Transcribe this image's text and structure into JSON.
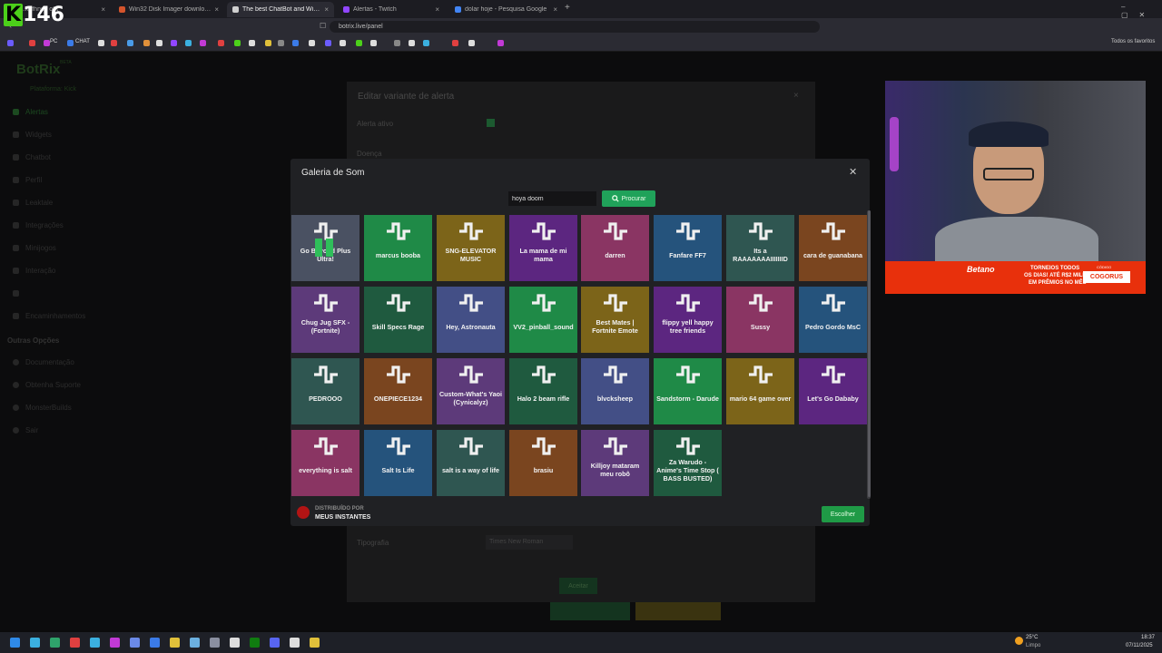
{
  "browser": {
    "tabs": [
      {
        "label": "...kefhney of t",
        "color": "#3b6ee8"
      },
      {
        "label": "Win32 Disk Imager download | Sour",
        "color": "#d4542c"
      },
      {
        "label": "The best ChatBot and Widget",
        "color": "#d0d0d0",
        "active": true
      },
      {
        "label": "Alertas - Twitch",
        "color": "#9146ff"
      },
      {
        "label": "dolar hoje - Pesquisa Google",
        "color": "#4285f4"
      }
    ],
    "url": "botrix.live/panel",
    "favorites_label": "Todos os favoritos",
    "bookmarks": [
      "PC",
      "CHAT"
    ]
  },
  "overlay_counter": {
    "letter": "K",
    "number": "146"
  },
  "sidebar": {
    "brand": "BotRix",
    "brand_badge": "BETA",
    "platform": "Plataforma: Kick",
    "items": [
      "Alertas",
      "Widgets",
      "Chatbot",
      "Perfil",
      "Leaktale",
      "Integrações",
      "Minijogos",
      "Interação",
      "",
      "Encaminhamentos"
    ],
    "other_title": "Outras Opções",
    "other_items": [
      "Documentação",
      "Obtenha Suporte",
      "MonsterBuilds",
      "Sair"
    ]
  },
  "edit_panel": {
    "title": "Editar variante de alerta",
    "active_label": "Alerta ativo",
    "type_label": "Doença",
    "typography_label": "Tipografia",
    "typography_value": "Times New Roman",
    "accept_label": "Aceitar"
  },
  "modal": {
    "title": "Galeria de Som",
    "search_value": "hoya doom",
    "search_button": "Procurar",
    "choose_button": "Escolher",
    "distributed_by": "DISTRIBUÍDO POR",
    "distributor": "MEUS INSTANTES",
    "sounds": [
      {
        "label": "Go Beyond Plus Ultra!",
        "color": "#4a5162",
        "playing": true
      },
      {
        "label": "marcus booba",
        "color": "#1f8a47"
      },
      {
        "label": "SNG-ELEVATOR MUSIC",
        "color": "#7c6419"
      },
      {
        "label": "La mama de mi mama",
        "color": "#5c2680"
      },
      {
        "label": "darren",
        "color": "#8a3563"
      },
      {
        "label": "Fanfare FF7",
        "color": "#25537c"
      },
      {
        "label": "Its a RAAAAAAAIIIIIIID",
        "color": "#2f5651"
      },
      {
        "label": "cara de guanabana",
        "color": "#7a451f"
      },
      {
        "label": "Chug Jug SFX - (Fortnite)",
        "color": "#5d3a7a"
      },
      {
        "label": "Skill Specs Rage",
        "color": "#1f5a3f"
      },
      {
        "label": "Hey, Astronauta",
        "color": "#434f86"
      },
      {
        "label": "VV2_pinball_sound",
        "color": "#1f8a47"
      },
      {
        "label": "Best Mates | Fortnite Emote",
        "color": "#7c6419"
      },
      {
        "label": "flippy yell happy tree friends",
        "color": "#5c2680"
      },
      {
        "label": "Sussy",
        "color": "#8a3563"
      },
      {
        "label": "Pedro Gordo MsC",
        "color": "#25537c"
      },
      {
        "label": "PEDROOO",
        "color": "#2f5651"
      },
      {
        "label": "ONEPIECE1234",
        "color": "#7a451f"
      },
      {
        "label": "Custom-What's Yaoi (Cynicalyz)",
        "color": "#5d3a7a"
      },
      {
        "label": "Halo 2 beam rifle",
        "color": "#1f5a3f"
      },
      {
        "label": "blvcksheep",
        "color": "#434f86"
      },
      {
        "label": "Sandstorm - Darude",
        "color": "#1f8a47"
      },
      {
        "label": "mario 64 game over",
        "color": "#7c6419"
      },
      {
        "label": "Let's Go Dababy",
        "color": "#5c2680"
      },
      {
        "label": "everything is salt",
        "color": "#8a3563"
      },
      {
        "label": "Salt Is Life",
        "color": "#25537c"
      },
      {
        "label": "salt is a way of life",
        "color": "#2f5651"
      },
      {
        "label": "brasiu",
        "color": "#7a451f"
      },
      {
        "label": "Killjoy mataram meu robô",
        "color": "#5d3a7a"
      },
      {
        "label": "Za Warudo - Anime's Time Stop ( BASS BUSTED)",
        "color": "#1f5a3f"
      }
    ]
  },
  "webcam_banner": {
    "brand": "Betano",
    "line1": "TORNEIOS TODOS",
    "line2": "OS DIAS! ATÉ R$2 MILHÕES",
    "line3": "EM PRÊMIOS NO MÊS",
    "code_label": "CÓDIGO",
    "code": "COGORUS"
  },
  "taskbar": {
    "weather_temp": "25°C",
    "weather_desc": "Limpo",
    "time": "18:37",
    "date": "07/11/2025"
  }
}
